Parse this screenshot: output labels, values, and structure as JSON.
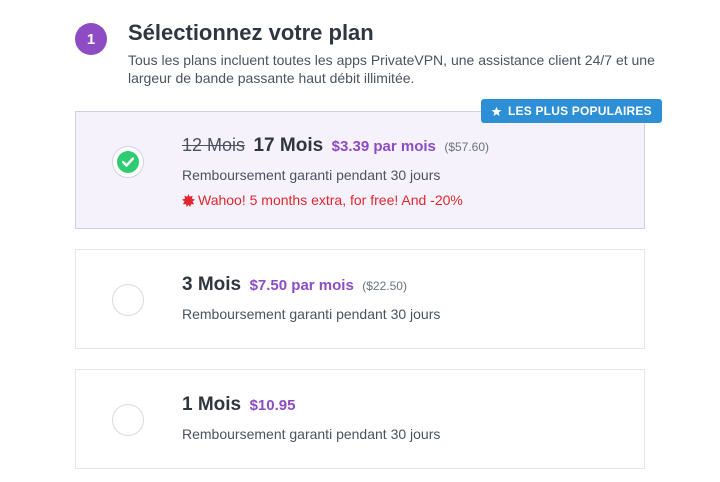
{
  "step": {
    "number": "1"
  },
  "header": {
    "title": "Sélectionnez votre plan",
    "subtitle": "Tous les plans incluent toutes les apps PrivateVPN, une assistance client 24/7 et une largeur de bande passante haut débit illimitée."
  },
  "badge": {
    "label": "LES PLUS POPULAIRES",
    "icon": "star-icon"
  },
  "plans": [
    {
      "selected": true,
      "old_duration": "12 Mois",
      "duration": "17 Mois",
      "price": "$3.39 par mois",
      "total": "($57.60)",
      "guarantee": "Remboursement garanti pendant 30 jours",
      "promo": "Wahoo! 5 months extra, for free! And -20%"
    },
    {
      "selected": false,
      "duration": "3 Mois",
      "price": "$7.50 par mois",
      "total": "($22.50)",
      "guarantee": "Remboursement garanti pendant 30 jours"
    },
    {
      "selected": false,
      "duration": "1 Mois",
      "price": "$10.95",
      "guarantee": "Remboursement garanti pendant 30 jours"
    }
  ],
  "colors": {
    "accent_purple": "#8e4cc4",
    "badge_blue": "#2d8fd6",
    "check_green": "#2ecc71",
    "promo_red": "#e3262e",
    "selected_bg": "#f6f2fb"
  }
}
